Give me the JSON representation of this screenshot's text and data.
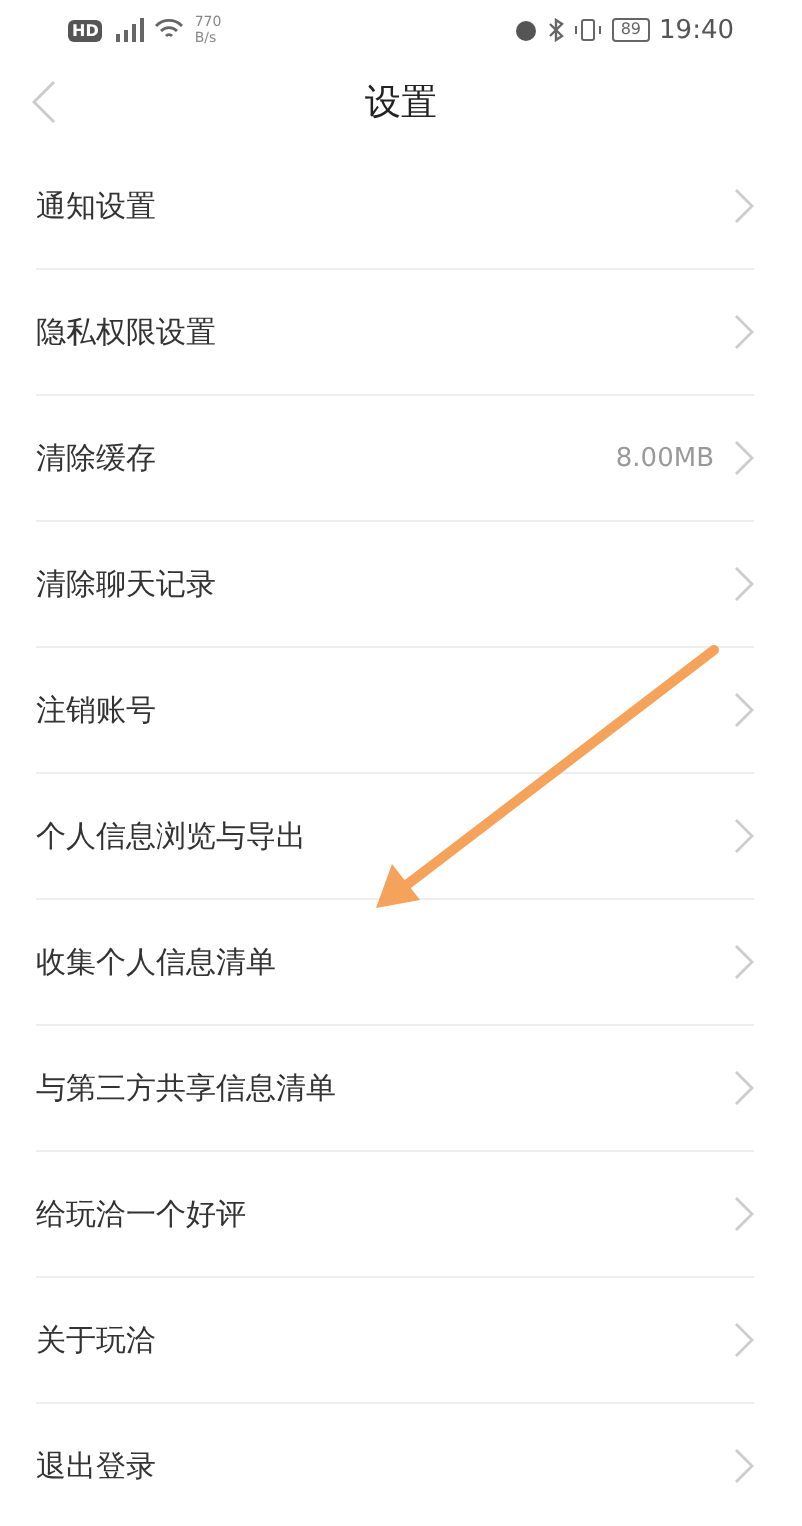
{
  "status_bar": {
    "hd": "HD",
    "speed_value": "770",
    "speed_unit": "B/s",
    "battery": "89",
    "time": "19:40"
  },
  "header": {
    "title": "设置"
  },
  "items": [
    {
      "label": "通知设置"
    },
    {
      "label": "隐私权限设置"
    },
    {
      "label": "清除缓存",
      "value": "8.00MB"
    },
    {
      "label": "清除聊天记录"
    },
    {
      "label": "注销账号"
    },
    {
      "label": "个人信息浏览与导出"
    },
    {
      "label": "收集个人信息清单"
    },
    {
      "label": "与第三方共享信息清单"
    },
    {
      "label": "给玩洽一个好评"
    },
    {
      "label": "关于玩洽"
    },
    {
      "label": "退出登录"
    }
  ]
}
